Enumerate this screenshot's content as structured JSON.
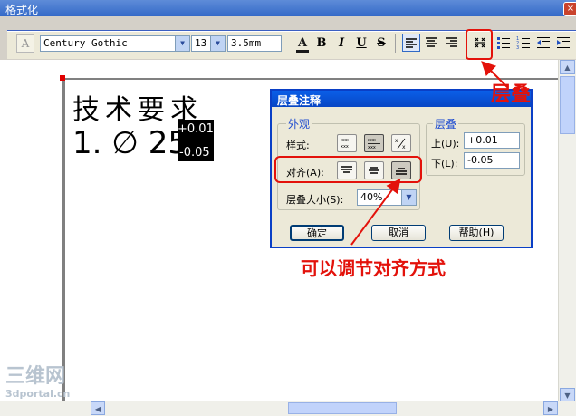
{
  "format_window": {
    "title": "格式化",
    "close_glyph": "×",
    "font_name": "Century Gothic",
    "font_size": "13",
    "text_height": "3.5mm",
    "bold_label": "B",
    "italic_label": "I",
    "underline_label": "U",
    "strike_label": "S",
    "color_label": "A"
  },
  "canvas": {
    "heading": "技术要求",
    "tolerance_prefix": "1.",
    "diameter_symbol": "∅",
    "nominal_value": "25",
    "upper_deviation": "+0.01",
    "lower_deviation": "-0.05"
  },
  "dialog": {
    "title": "层叠注释",
    "appearance_group": "外观",
    "style_label": "样式:",
    "align_label": "对齐(A):",
    "size_label": "层叠大小(S):",
    "size_value": "40%",
    "stack_group": "层叠",
    "upper_label": "上(U):",
    "upper_value": "+0.01",
    "lower_label": "下(L):",
    "lower_value": "-0.05",
    "ok_button": "确定",
    "cancel_button": "取消",
    "help_button": "帮助(H)"
  },
  "annotations": {
    "stack_callout": "层叠",
    "align_callout": "可以调节对齐方式"
  },
  "watermark": {
    "line1": "三维网",
    "line2": "3dportal.cn"
  },
  "colors": {
    "annotation_red": "#e3120b",
    "title_blue": "#0a5fe8",
    "toolbar_bg": "#ece9d8"
  }
}
